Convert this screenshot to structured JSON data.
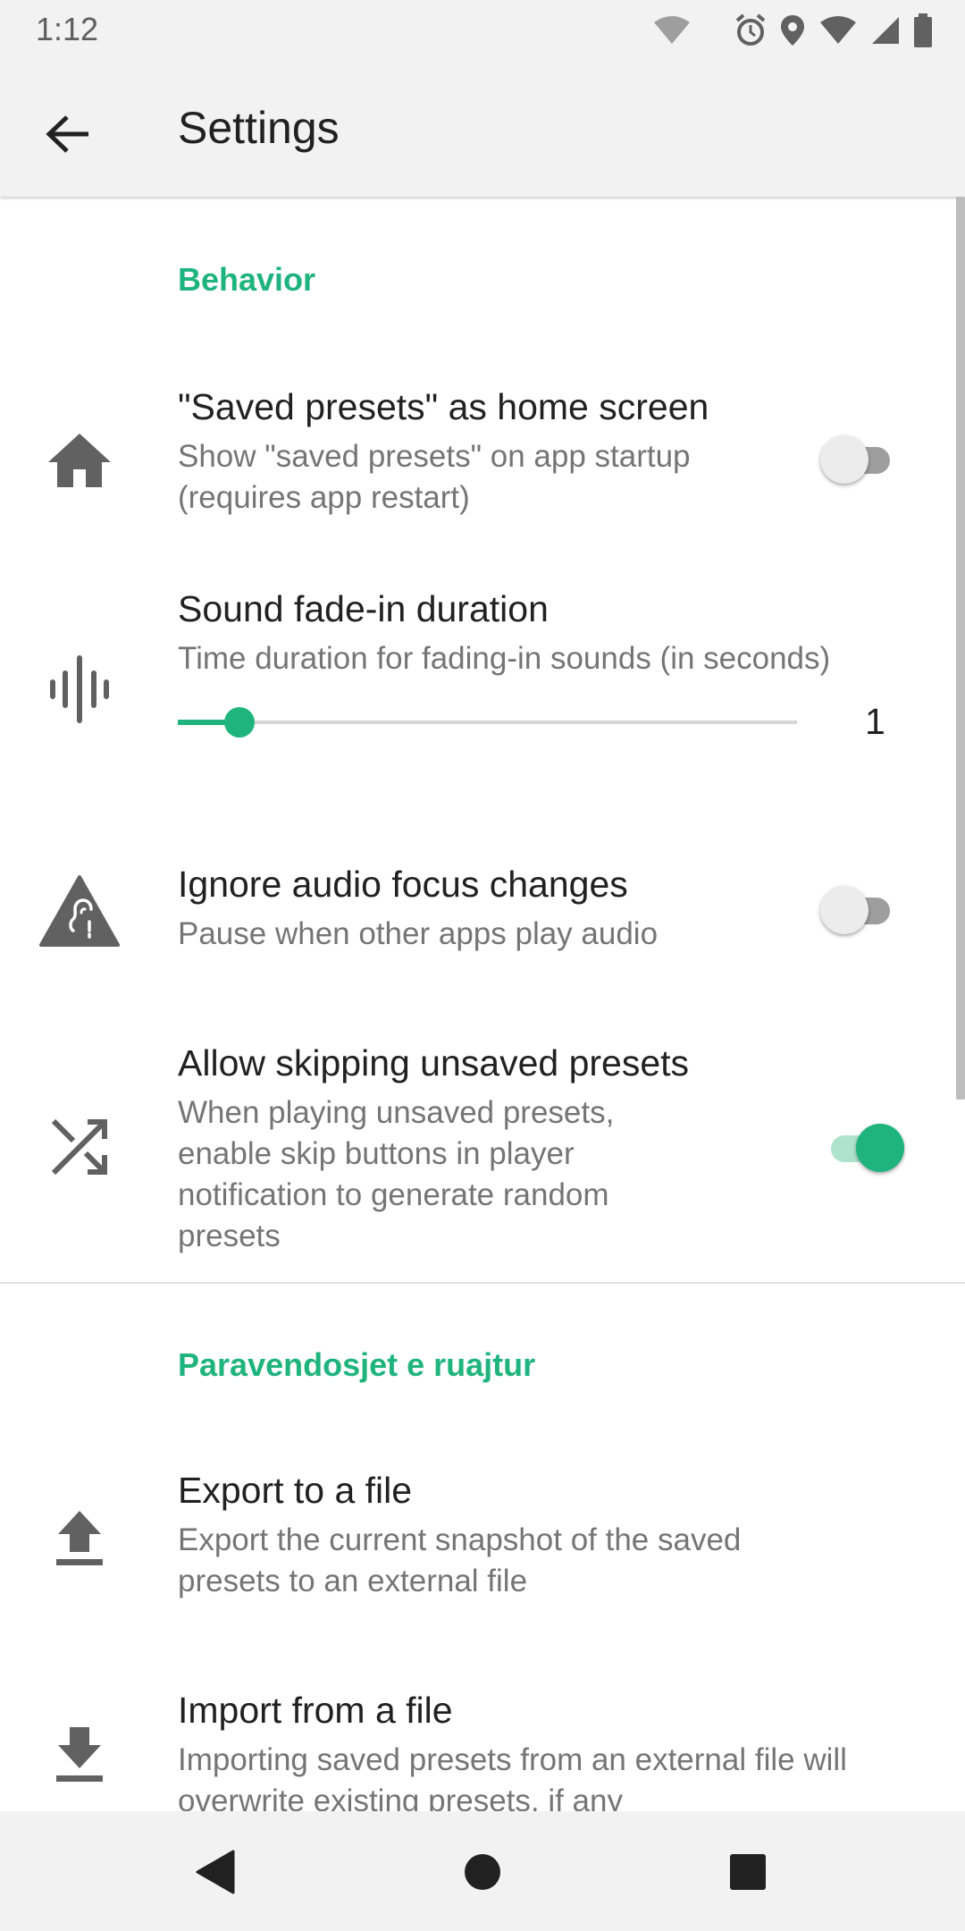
{
  "status_bar": {
    "time": "1:12",
    "icons": [
      "wifi-icon",
      "alarm-icon",
      "location-icon",
      "wifi-signal-icon",
      "cell-signal-icon",
      "battery-icon"
    ]
  },
  "app_bar": {
    "title": "Settings",
    "back_icon": "arrow-back-icon"
  },
  "colors": {
    "accent": "#1fb47e",
    "text_primary": "#212121",
    "text_secondary": "#757575",
    "icon": "#616161",
    "bar_background": "#f2f2f2"
  },
  "sections": [
    {
      "header": "Behavior",
      "items": [
        {
          "icon": "home-icon",
          "title": "\"Saved presets\" as home screen",
          "summary": "Show \"saved presets\" on app startup (requires app restart)",
          "control": "switch",
          "checked": false
        },
        {
          "icon": "waveform-icon",
          "title": "Sound fade-in duration",
          "summary": "Time duration for fading-in sounds (in seconds)",
          "control": "slider",
          "value": "1",
          "slider_fraction": 0.1
        },
        {
          "icon": "hearing-warning-icon",
          "title": "Ignore audio focus changes",
          "summary": "Pause when other apps play audio",
          "control": "switch",
          "checked": false
        },
        {
          "icon": "shuffle-icon",
          "title": "Allow skipping unsaved presets",
          "summary": "When playing unsaved presets, enable skip buttons in player notification to generate random presets",
          "control": "switch",
          "checked": true
        }
      ]
    },
    {
      "header": "Paravendosjet e ruajtur",
      "items": [
        {
          "icon": "upload-icon",
          "title": "Export to a file",
          "summary": "Export the current snapshot of the saved presets to an external file"
        },
        {
          "icon": "download-icon",
          "title": "Import from a file",
          "summary": "Importing saved presets from an external file will overwrite existing presets, if any"
        }
      ]
    }
  ],
  "nav_bar": {
    "buttons": [
      "nav-back-icon",
      "nav-home-icon",
      "nav-recents-icon"
    ]
  }
}
